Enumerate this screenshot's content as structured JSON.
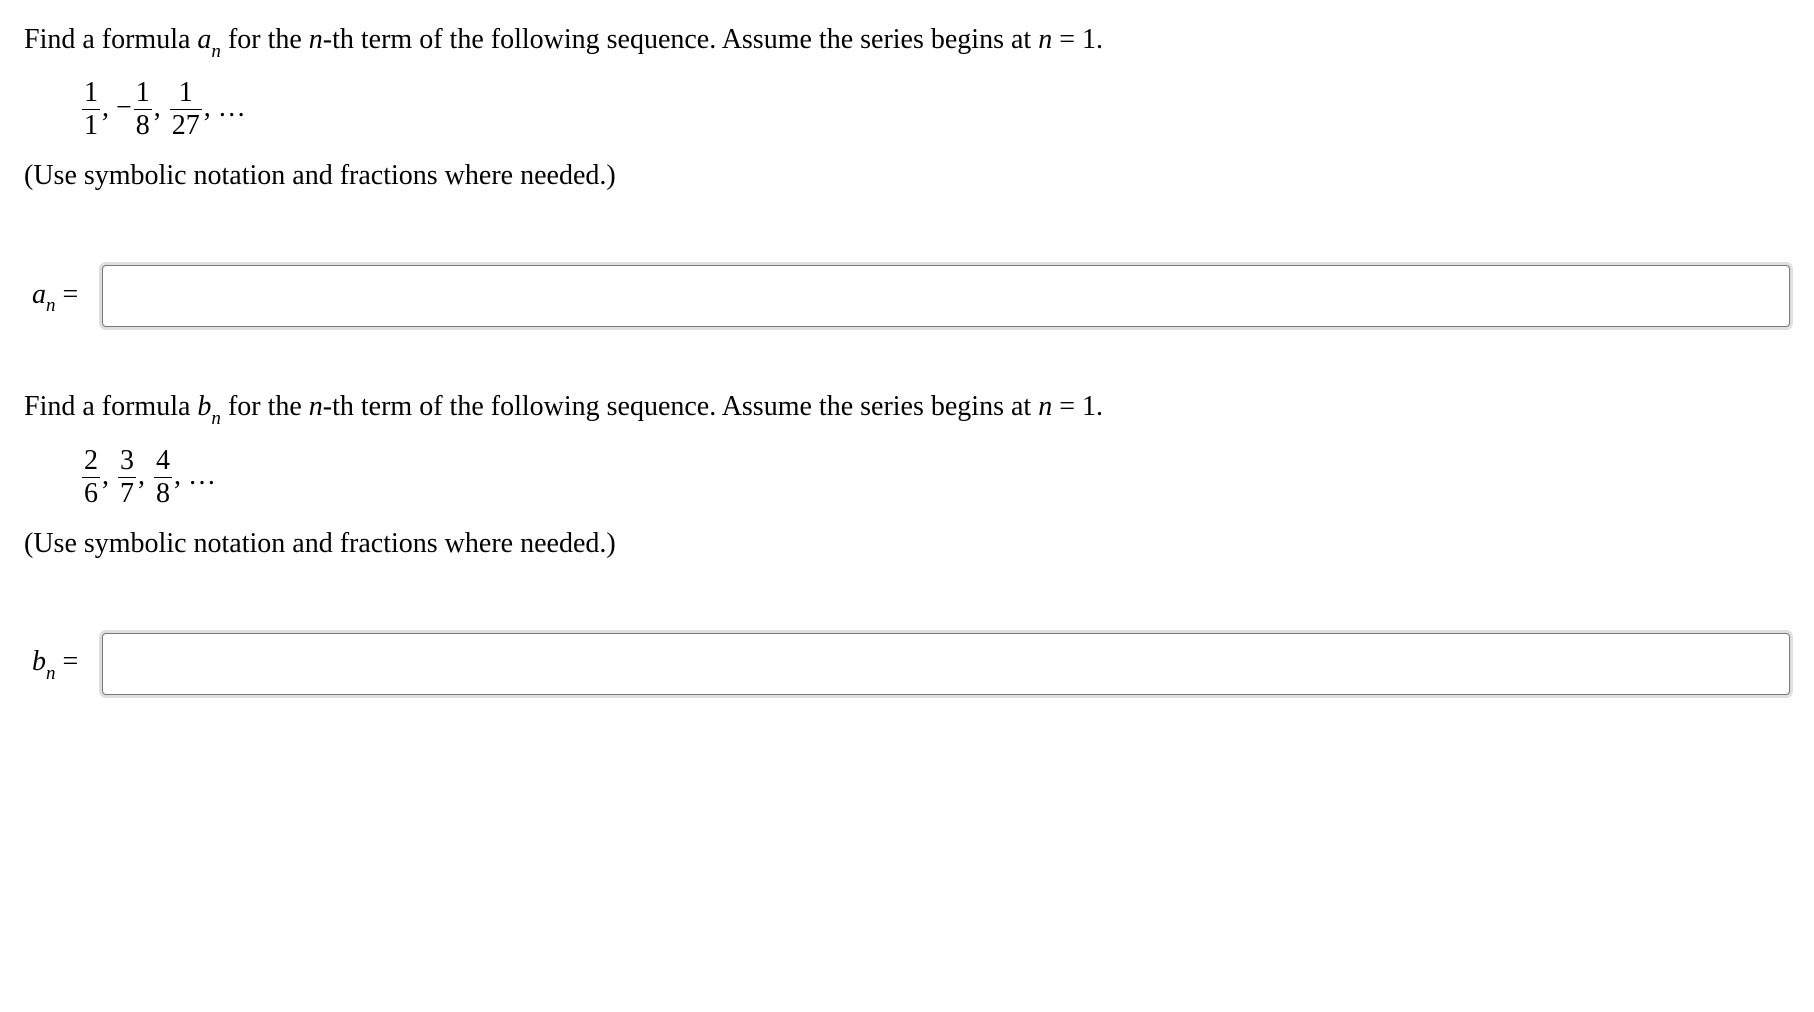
{
  "q1": {
    "prompt_prefix": "Find a formula ",
    "var_letter": "a",
    "var_sub": "n",
    "prompt_mid": " for the ",
    "nth_text": "n",
    "prompt_suffix_1": "-th term of the following sequence. Assume the series begins at ",
    "n_equals": "n",
    "equals_text": " = 1.",
    "seq_f1_top": "1",
    "seq_f1_bot": "1",
    "sep1": ", ",
    "neg": "−",
    "seq_f2_top": "1",
    "seq_f2_bot": "8",
    "sep2": ", ",
    "seq_f3_top": "1",
    "seq_f3_bot": "27",
    "seq_tail": ", …",
    "hint": "(Use symbolic notation and fractions where needed.)",
    "answer_label_var": "a",
    "answer_label_sub": "n",
    "answer_label_eq": " =",
    "input_value": ""
  },
  "q2": {
    "prompt_prefix": "Find a formula ",
    "var_letter": "b",
    "var_sub": "n",
    "prompt_mid": " for the ",
    "nth_text": "n",
    "prompt_suffix_1": "-th term of the following sequence. Assume the series begins at ",
    "n_equals": "n",
    "equals_text": " = 1.",
    "seq_f1_top": "2",
    "seq_f1_bot": "6",
    "sep1": ", ",
    "seq_f2_top": "3",
    "seq_f2_bot": "7",
    "sep2": ", ",
    "seq_f3_top": "4",
    "seq_f3_bot": "8",
    "seq_tail": ", …",
    "hint": "(Use symbolic notation and fractions where needed.)",
    "answer_label_var": "b",
    "answer_label_sub": "n",
    "answer_label_eq": " =",
    "input_value": ""
  }
}
